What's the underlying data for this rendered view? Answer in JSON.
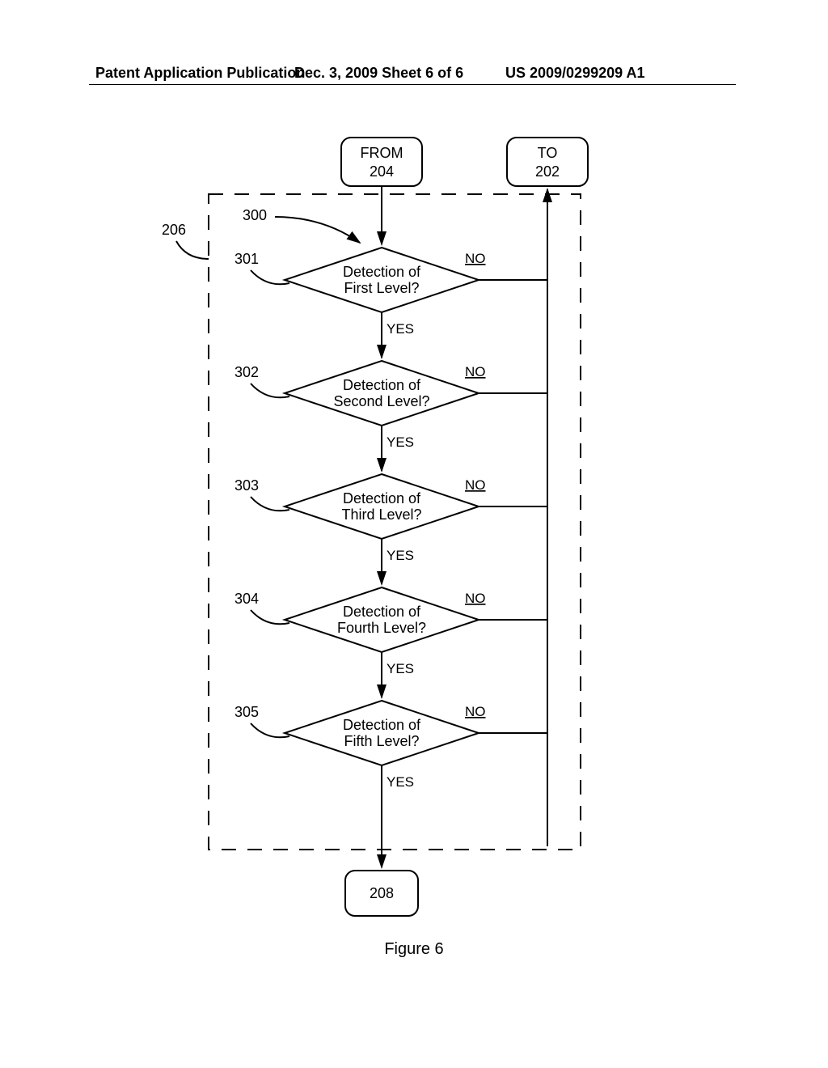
{
  "header": {
    "left": "Patent Application Publication",
    "center": "Dec. 3, 2009  Sheet 6 of 6",
    "right": "US 2009/0299209 A1"
  },
  "figure_label": "Figure 6",
  "nodes": {
    "from": {
      "line1": "FROM",
      "line2": "204"
    },
    "to": {
      "line1": "TO",
      "line2": "202"
    },
    "exit": {
      "label": "208"
    },
    "d1": {
      "line1": "Detection of",
      "line2": "First Level?"
    },
    "d2": {
      "line1": "Detection of",
      "line2": "Second Level?"
    },
    "d3": {
      "line1": "Detection of",
      "line2": "Third Level?"
    },
    "d4": {
      "line1": "Detection of",
      "line2": "Fourth Level?"
    },
    "d5": {
      "line1": "Detection of",
      "line2": "Fifth Level?"
    }
  },
  "refs": {
    "r206": "206",
    "r300": "300",
    "r301": "301",
    "r302": "302",
    "r303": "303",
    "r304": "304",
    "r305": "305"
  },
  "labels": {
    "yes": "YES",
    "no": "NO"
  },
  "chart_data": {
    "type": "flowchart",
    "title": "Figure 6",
    "nodes": [
      {
        "id": "from204",
        "type": "terminal",
        "label": "FROM 204"
      },
      {
        "id": "to202",
        "type": "terminal",
        "label": "TO 202"
      },
      {
        "id": "d301",
        "type": "decision",
        "label": "Detection of First Level?",
        "ref": "301"
      },
      {
        "id": "d302",
        "type": "decision",
        "label": "Detection of Second Level?",
        "ref": "302"
      },
      {
        "id": "d303",
        "type": "decision",
        "label": "Detection of Third Level?",
        "ref": "303"
      },
      {
        "id": "d304",
        "type": "decision",
        "label": "Detection of Fourth Level?",
        "ref": "304"
      },
      {
        "id": "d305",
        "type": "decision",
        "label": "Detection of Fifth Level?",
        "ref": "305"
      },
      {
        "id": "exit208",
        "type": "terminal",
        "label": "208"
      }
    ],
    "edges": [
      {
        "from": "from204",
        "to": "d301",
        "label": ""
      },
      {
        "from": "d301",
        "to": "d302",
        "label": "YES"
      },
      {
        "from": "d301",
        "to": "to202",
        "label": "NO"
      },
      {
        "from": "d302",
        "to": "d303",
        "label": "YES"
      },
      {
        "from": "d302",
        "to": "to202",
        "label": "NO"
      },
      {
        "from": "d303",
        "to": "d304",
        "label": "YES"
      },
      {
        "from": "d303",
        "to": "to202",
        "label": "NO"
      },
      {
        "from": "d304",
        "to": "d305",
        "label": "YES"
      },
      {
        "from": "d304",
        "to": "to202",
        "label": "NO"
      },
      {
        "from": "d305",
        "to": "exit208",
        "label": "YES"
      },
      {
        "from": "d305",
        "to": "to202",
        "label": "NO"
      }
    ],
    "group": {
      "ref": "206",
      "contains_ref": "300",
      "members": [
        "d301",
        "d302",
        "d303",
        "d304",
        "d305"
      ]
    }
  }
}
